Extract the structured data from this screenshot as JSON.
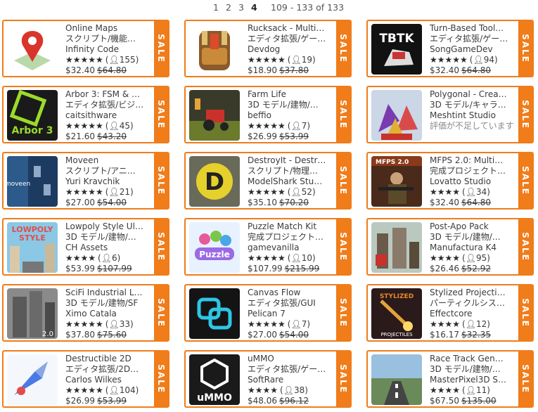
{
  "pager": {
    "pages": [
      "1",
      "2",
      "3",
      "4"
    ],
    "current": "4",
    "range": "109 - 133 of 133"
  },
  "colors": {
    "accent": "#f07c1a"
  },
  "products": [
    {
      "title": "Online Maps",
      "category": "スクリプト/機能…",
      "publisher": "Infinity Code",
      "rating": "★★★★★",
      "reviews": "155",
      "price": "$32.40",
      "original_price": "$64.80",
      "badge": "SALE",
      "icon": "map-pin-icon"
    },
    {
      "title": "Rucksack - Multi…",
      "category": "エディタ拡張/ゲー…",
      "publisher": "Devdog",
      "rating": "★★★★★",
      "reviews": "19",
      "price": "$18.90",
      "original_price": "$37.80",
      "badge": "SALE",
      "icon": "backpack-icon"
    },
    {
      "title": "Turn-Based Tool…",
      "category": "エディタ拡張/ゲー…",
      "publisher": "SongGameDev",
      "rating": "★★★★★",
      "reviews": "94",
      "price": "$32.40",
      "original_price": "$64.80",
      "badge": "SALE",
      "icon": "tbtk-logo-icon"
    },
    {
      "title": "Arbor 3: FSM & …",
      "category": "エディタ拡張/ビジ…",
      "publisher": "caitsithware",
      "rating": "★★★★★",
      "reviews": "45",
      "price": "$21.60",
      "original_price": "$43.20",
      "badge": "SALE",
      "icon": "arbor-logo-icon"
    },
    {
      "title": "Farm Life",
      "category": "3D モデル/建物/…",
      "publisher": "beffio",
      "rating": "★★★★★",
      "reviews": "7",
      "price": "$26.99",
      "original_price": "$53.99",
      "badge": "SALE",
      "icon": "tractor-icon"
    },
    {
      "title": "Polygonal - Crea…",
      "category": "3D モデル/キャラ…",
      "publisher": "Meshtint Studio",
      "rating_note": "評価が不足しています",
      "price": "$43.15",
      "original_price": "$86.29",
      "badge": "SALE",
      "icon": "polygonal-creatures-icon"
    },
    {
      "title": "Moveen",
      "category": "スクリプト/アニ…",
      "publisher": "Yuri Kravchik",
      "rating": "★★★★★",
      "reviews": "21",
      "price": "$27.00",
      "original_price": "$54.00",
      "badge": "SALE",
      "icon": "moveen-logo-icon"
    },
    {
      "title": "DestroyIt - Destr…",
      "category": "スクリプト/物理…",
      "publisher": "ModelShark Stu…",
      "rating": "★★★★★",
      "reviews": "52",
      "price": "$35.10",
      "original_price": "$70.20",
      "badge": "SALE",
      "icon": "destroyit-logo-icon"
    },
    {
      "title": "MFPS 2.0: Multi…",
      "category": "完成プロジェクト…",
      "publisher": "Lovatto Studio",
      "rating": "★★★★",
      "reviews": "34",
      "price": "$32.40",
      "original_price": "$64.80",
      "badge": "SALE",
      "icon": "soldier-icon"
    },
    {
      "title": "Lowpoly Style Ul…",
      "category": "3D モデル/建物/…",
      "publisher": "CH Assets",
      "rating": "★★★★",
      "reviews": "6",
      "price": "$53.99",
      "original_price": "$107.99",
      "badge": "SALE",
      "icon": "lowpoly-city-icon"
    },
    {
      "title": "Puzzle Match Kit",
      "category": "完成プロジェクト…",
      "publisher": "gamevanilla",
      "rating": "★★★★★",
      "reviews": "10",
      "price": "$107.99",
      "original_price": "$215.99",
      "badge": "SALE",
      "icon": "puzzle-logo-icon"
    },
    {
      "title": "Post-Apo Pack",
      "category": "3D モデル/建物/…",
      "publisher": "Manufactura K4",
      "rating": "★★★★",
      "reviews": "95",
      "price": "$26.46",
      "original_price": "$52.92",
      "badge": "SALE",
      "icon": "ruins-icon"
    },
    {
      "title": "SciFi Industrial L…",
      "category": "3D モデル/建物/SF",
      "publisher": "Ximo Catala",
      "rating": "★★★★★",
      "reviews": "33",
      "price": "$37.80",
      "original_price": "$75.60",
      "badge": "SALE",
      "icon": "scifi-level-icon"
    },
    {
      "title": "Canvas Flow",
      "category": "エディタ拡張/GUI",
      "publisher": "Pelican 7",
      "rating": "★★★★★",
      "reviews": "7",
      "price": "$27.00",
      "original_price": "$54.00",
      "badge": "SALE",
      "icon": "canvas-flow-logo-icon"
    },
    {
      "title": "Stylized Projecti…",
      "category": "パーティクルシス…",
      "publisher": "Effectcore",
      "rating": "★★★★",
      "reviews": "12",
      "price": "$16.17",
      "original_price": "$32.35",
      "badge": "SALE",
      "icon": "projectile-icon"
    },
    {
      "title": "Destructible 2D",
      "category": "エディタ拡張/2D…",
      "publisher": "Carlos Wilkes",
      "rating": "★★★★★",
      "reviews": "104",
      "price": "$26.99",
      "original_price": "$53.99",
      "badge": "SALE",
      "icon": "spaceship-icon"
    },
    {
      "title": "uMMO",
      "category": "エディタ拡張/ゲー…",
      "publisher": "SoftRare",
      "rating": "★★★★",
      "reviews": "38",
      "price": "$48.06",
      "original_price": "$96.12",
      "badge": "SALE",
      "icon": "ummo-logo-icon"
    },
    {
      "title": "Race Track Gen…",
      "category": "3D モデル/建物/…",
      "publisher": "MasterPixel3D S…",
      "rating": "★★★★",
      "reviews": "11",
      "price": "$67.50",
      "original_price": "$135.00",
      "badge": "SALE",
      "icon": "race-track-icon"
    }
  ]
}
